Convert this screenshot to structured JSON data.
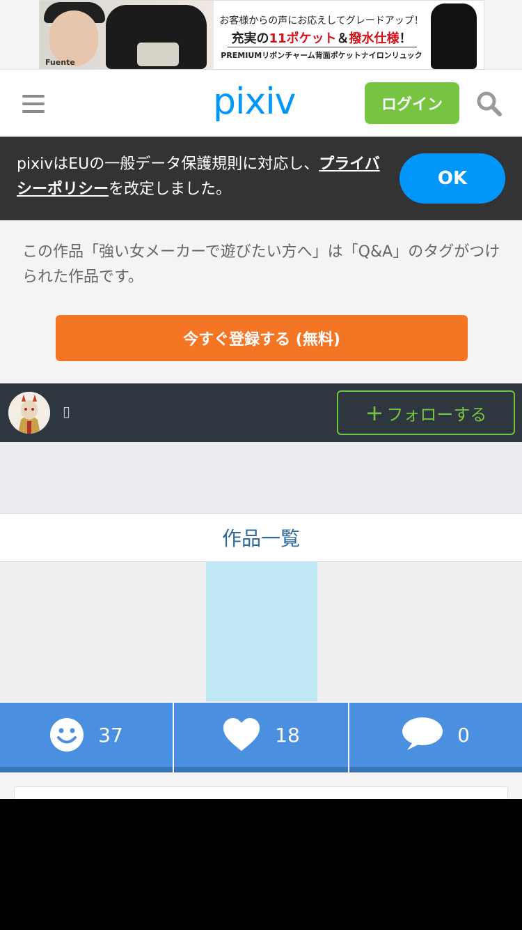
{
  "ad": {
    "line1": "お客様からの声にお応えしてグレードアップ！",
    "line2_prefix": "充実の",
    "line2_red1": "11ポケット",
    "line2_mid": "＆",
    "line2_red2": "撥水仕様",
    "line2_suffix": "！",
    "line3": "PREMIUMリボンチャーム背面ポケットナイロンリュック",
    "brand": "Fuente"
  },
  "header": {
    "logo": "pixiv",
    "login_label": "ログイン"
  },
  "gdpr": {
    "text_before": "pixivはEUの一般データ保護規則に対応し、",
    "link_label": "プライバシーポリシー",
    "text_after": "を改定しました。",
    "ok_label": "OK"
  },
  "intro": {
    "text": "この作品「強い女メーカーで遊びたい方へ」は「Q&A」のタグがつけられた作品です。",
    "register_label": "今すぐ登録する (無料)"
  },
  "user": {
    "name": "▯",
    "follow_plus": "+",
    "follow_label": "フォローする"
  },
  "works": {
    "title": "作品一覧"
  },
  "stats": {
    "likes": "37",
    "bookmarks": "18",
    "comments": "0"
  },
  "colors": {
    "pixiv_blue": "#0096fa",
    "login_green": "#76c442",
    "register_orange": "#f47524",
    "stats_blue": "#4a8fe0"
  }
}
